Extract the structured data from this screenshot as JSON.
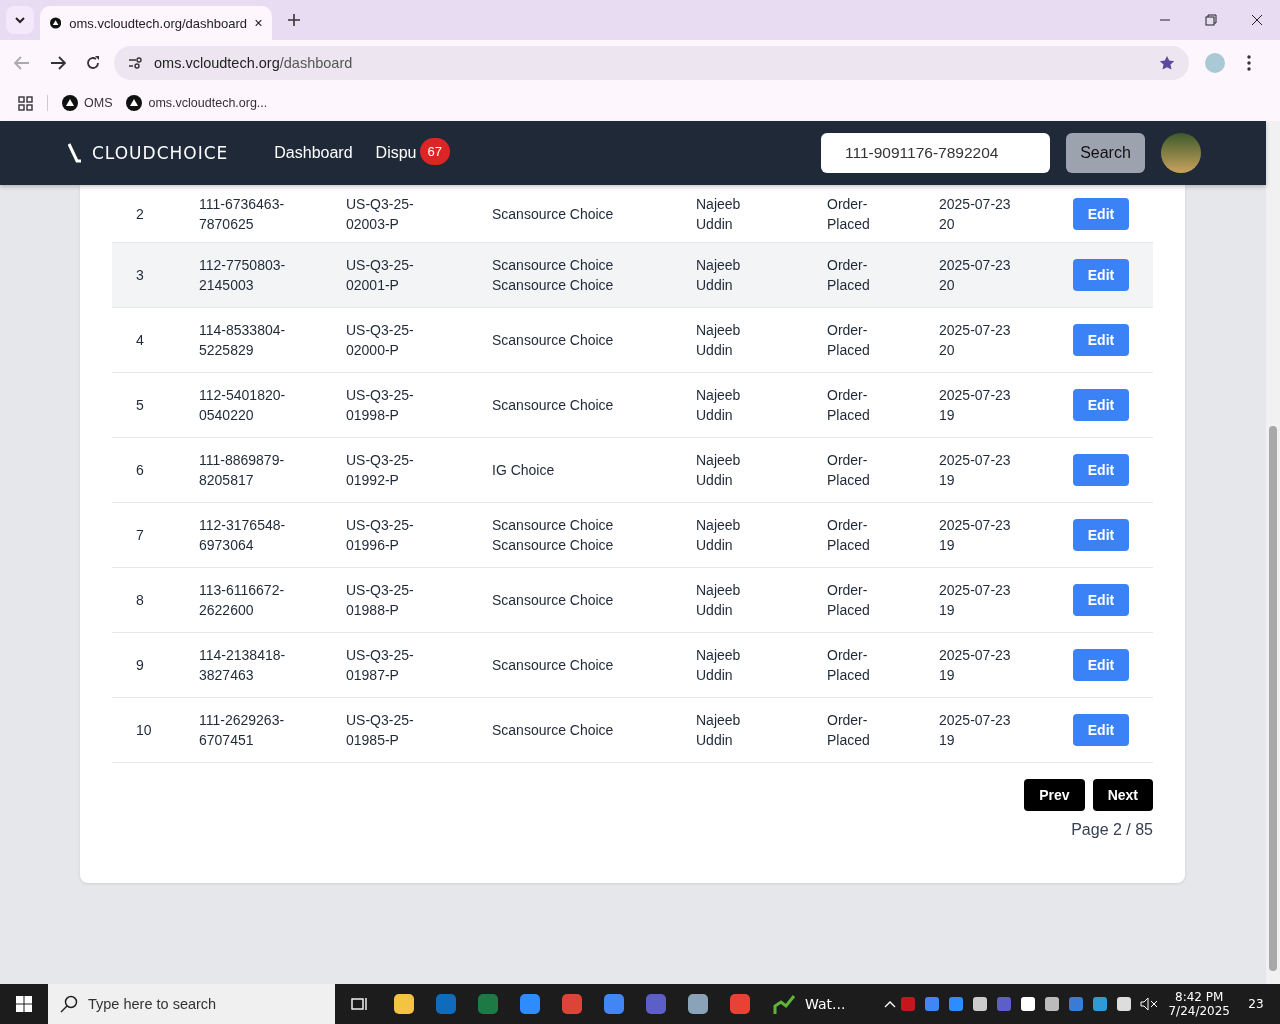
{
  "browser": {
    "tab_title": "oms.vcloudtech.org/dashboard",
    "url_host": "oms.vcloudtech.org",
    "url_path": "/dashboard",
    "bookmarks": [
      "OMS",
      "oms.vcloudtech.org..."
    ]
  },
  "nav": {
    "logo": "CLOUDCHOICE",
    "links": [
      "Dashboard",
      "Dispu"
    ],
    "badge": "67",
    "search_value": "111-9091176-7892204",
    "search_button": "Search"
  },
  "rows": [
    {
      "num": "2",
      "order_id": "111-6736463-7870625",
      "po": "US-Q3-25-02003-P",
      "supplier": "Scansource Choice",
      "user": "Najeeb Uddin",
      "status": "Order-Placed",
      "date": "2025-07-23 20",
      "action": "Edit",
      "highlighted": false
    },
    {
      "num": "3",
      "order_id": "112-7750803-2145003",
      "po": "US-Q3-25-02001-P",
      "supplier": "Scansource Choice Scansource Choice",
      "user": "Najeeb Uddin",
      "status": "Order-Placed",
      "date": "2025-07-23 20",
      "action": "Edit",
      "highlighted": true
    },
    {
      "num": "4",
      "order_id": "114-8533804-5225829",
      "po": "US-Q3-25-02000-P",
      "supplier": "Scansource Choice",
      "user": "Najeeb Uddin",
      "status": "Order-Placed",
      "date": "2025-07-23 20",
      "action": "Edit",
      "highlighted": false
    },
    {
      "num": "5",
      "order_id": "112-5401820-0540220",
      "po": "US-Q3-25-01998-P",
      "supplier": "Scansource Choice",
      "user": "Najeeb Uddin",
      "status": "Order-Placed",
      "date": "2025-07-23 19",
      "action": "Edit",
      "highlighted": false
    },
    {
      "num": "6",
      "order_id": "111-8869879-8205817",
      "po": "US-Q3-25-01992-P",
      "supplier": "IG Choice",
      "user": "Najeeb Uddin",
      "status": "Order-Placed",
      "date": "2025-07-23 19",
      "action": "Edit",
      "highlighted": false
    },
    {
      "num": "7",
      "order_id": "112-3176548-6973064",
      "po": "US-Q3-25-01996-P",
      "supplier": "Scansource Choice Scansource Choice",
      "user": "Najeeb Uddin",
      "status": "Order-Placed",
      "date": "2025-07-23 19",
      "action": "Edit",
      "highlighted": false
    },
    {
      "num": "8",
      "order_id": "113-6116672-2622600",
      "po": "US-Q3-25-01988-P",
      "supplier": "Scansource Choice",
      "user": "Najeeb Uddin",
      "status": "Order-Placed",
      "date": "2025-07-23 19",
      "action": "Edit",
      "highlighted": false
    },
    {
      "num": "9",
      "order_id": "114-2138418-3827463",
      "po": "US-Q3-25-01987-P",
      "supplier": "Scansource Choice",
      "user": "Najeeb Uddin",
      "status": "Order-Placed",
      "date": "2025-07-23 19",
      "action": "Edit",
      "highlighted": false
    },
    {
      "num": "10",
      "order_id": "111-2629263-6707451",
      "po": "US-Q3-25-01985-P",
      "supplier": "Scansource Choice",
      "user": "Najeeb Uddin",
      "status": "Order-Placed",
      "date": "2025-07-23 19",
      "action": "Edit",
      "highlighted": false
    }
  ],
  "pagination": {
    "prev": "Prev",
    "next": "Next",
    "page_info": "Page 2 / 85"
  },
  "taskbar": {
    "search_placeholder": "Type here to search",
    "app_label": "Wat...",
    "time": "8:42 PM",
    "date": "7/24/2025",
    "notifications": "23"
  }
}
